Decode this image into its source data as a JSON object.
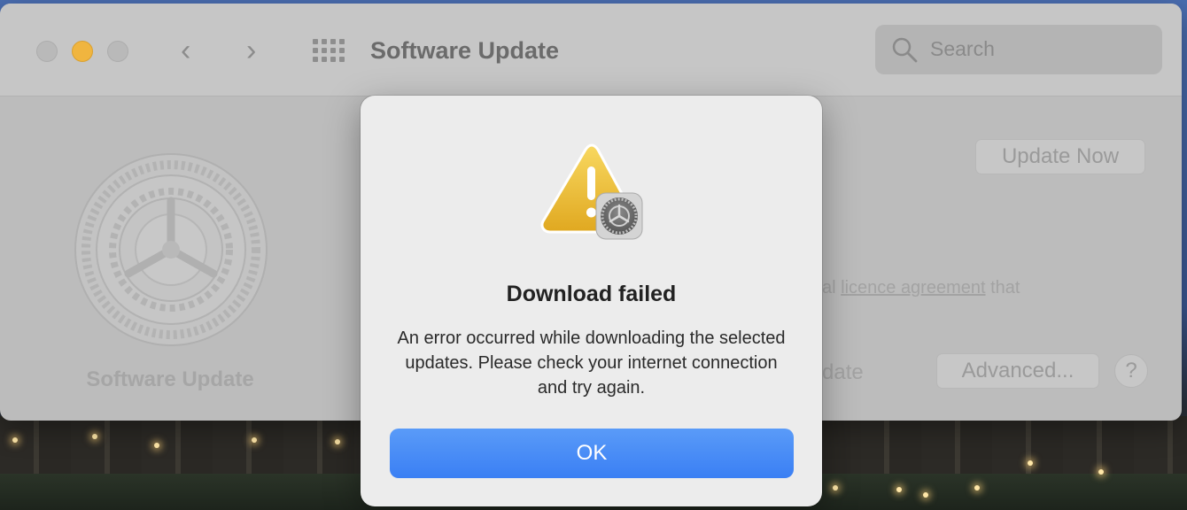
{
  "window": {
    "title": "Software Update",
    "search_placeholder": "Search",
    "nav_back": "‹",
    "nav_forward": "›"
  },
  "pane": {
    "label": "Software Update",
    "update_now_label": "Update Now",
    "licence_prefix": "al ",
    "licence_link": "licence agreement",
    "licence_suffix": " that",
    "auto_update_fragment": "date",
    "advanced_label": "Advanced...",
    "help_label": "?"
  },
  "alert": {
    "title": "Download failed",
    "message": "An error occurred while downloading the selected updates. Please check your internet connection and try again.",
    "ok_label": "OK"
  },
  "colors": {
    "accent": "#3a7ff4",
    "minimize": "#f0b53f",
    "warning": "#f2c230"
  }
}
